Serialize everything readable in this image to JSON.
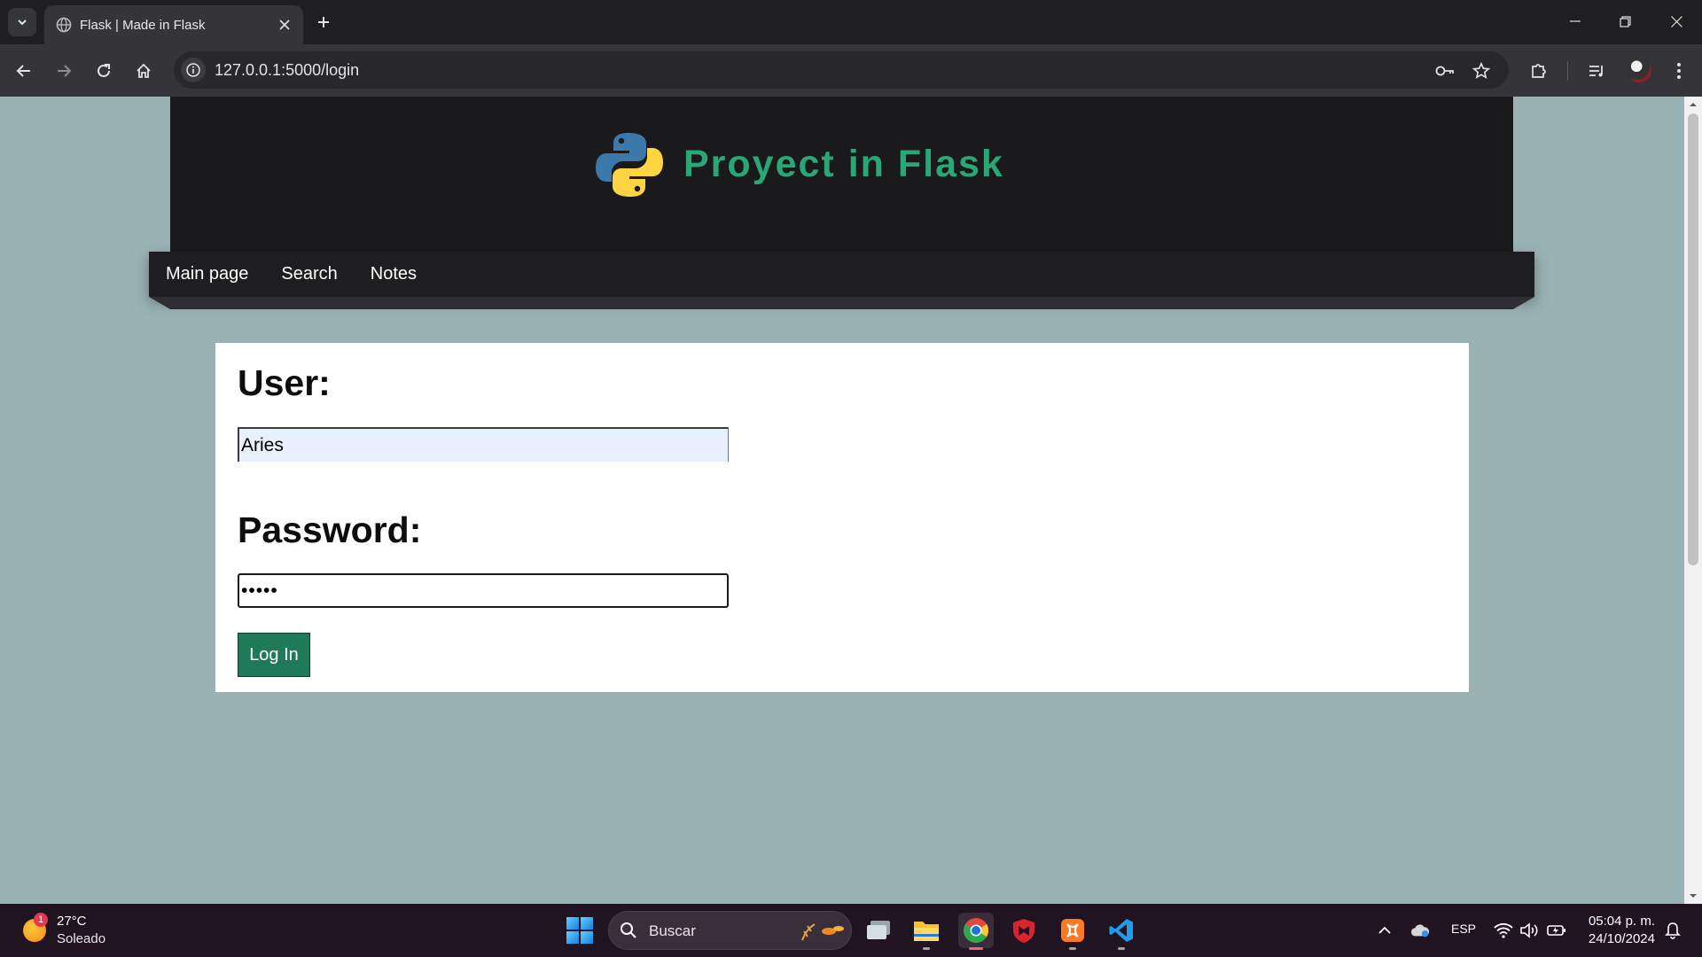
{
  "browser": {
    "tab_title": "Flask | Made in Flask",
    "url": "127.0.0.1:5000/login"
  },
  "site": {
    "title": "Proyect in Flask",
    "nav": [
      {
        "label": "Main page"
      },
      {
        "label": "Search"
      },
      {
        "label": "Notes"
      }
    ]
  },
  "login": {
    "user_label": "User:",
    "user_value": "Aries",
    "password_label": "Password:",
    "password_value": "aries",
    "submit_label": "Log In"
  },
  "taskbar": {
    "weather_temp": "27°C",
    "weather_desc": "Soleado",
    "weather_badge": "1",
    "search_label": "Buscar",
    "language": "ESP",
    "time": "05:04 p. m.",
    "date": "24/10/2024"
  },
  "colors": {
    "page_background": "#99b2b3",
    "header_background": "#1a191b",
    "title_green": "#2aa776",
    "button_green": "#1f7b57",
    "autofill_blue": "#e8f0fe"
  },
  "icons": {
    "logo": "python-logo-icon",
    "tab_favicon": "globe-icon"
  }
}
